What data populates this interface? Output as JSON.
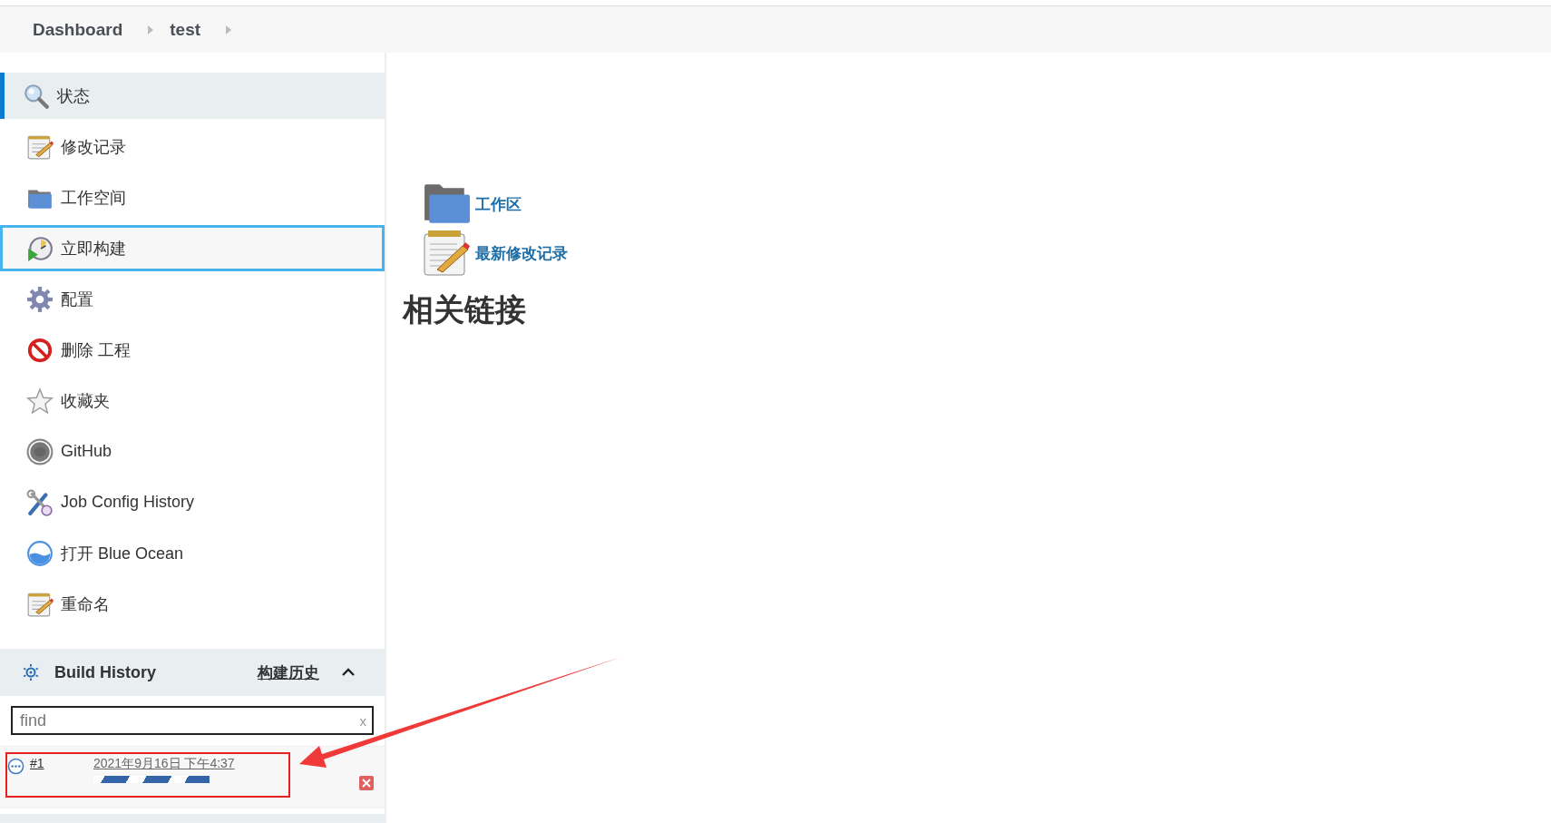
{
  "breadcrumb": [
    {
      "label": "Dashboard"
    },
    {
      "label": "test"
    }
  ],
  "sidebar": {
    "items": [
      {
        "kind": "status",
        "label": "状态",
        "selected": true,
        "focused": false
      },
      {
        "kind": "changes",
        "label": "修改记录",
        "selected": false,
        "focused": false
      },
      {
        "kind": "workspace",
        "label": "工作空间",
        "selected": false,
        "focused": false
      },
      {
        "kind": "build",
        "label": "立即构建",
        "selected": false,
        "focused": true
      },
      {
        "kind": "configure",
        "label": "配置",
        "selected": false,
        "focused": false
      },
      {
        "kind": "delete",
        "label": "删除 工程",
        "selected": false,
        "focused": false
      },
      {
        "kind": "favorite",
        "label": "收藏夹",
        "selected": false,
        "focused": false
      },
      {
        "kind": "github",
        "label": "GitHub",
        "selected": false,
        "focused": false
      },
      {
        "kind": "config-history",
        "label": "Job Config History",
        "selected": false,
        "focused": false
      },
      {
        "kind": "blue-ocean",
        "label": "打开 Blue Ocean",
        "selected": false,
        "focused": false
      },
      {
        "kind": "rename",
        "label": "重命名",
        "selected": false,
        "focused": false
      }
    ]
  },
  "build_history": {
    "title": "Build History",
    "trend_link": "构建历史",
    "expanded": true,
    "search": {
      "placeholder": "find",
      "clear": "x"
    },
    "builds": [
      {
        "number": "#1",
        "date": "2021年9月16日 下午4:37",
        "in_progress": true
      }
    ]
  },
  "main": {
    "links": [
      {
        "kind": "workspace",
        "label": "工作区"
      },
      {
        "kind": "changes",
        "label": "最新修改记录"
      }
    ],
    "related_heading": "相关链接"
  }
}
